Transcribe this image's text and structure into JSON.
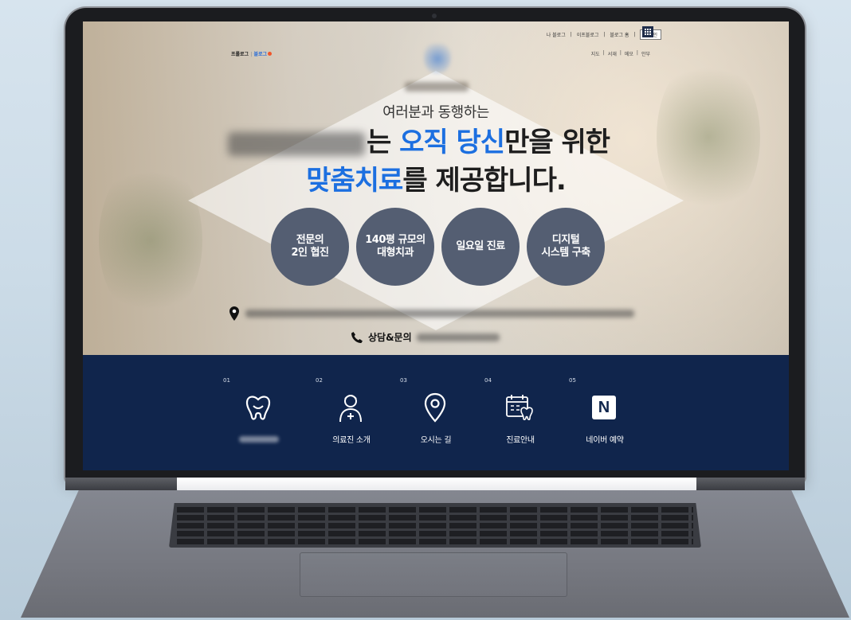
{
  "header": {
    "util_links": [
      "나 블로그",
      "이프블로그",
      "블로그 홈",
      "로그인"
    ],
    "util_links2": [
      "지도",
      "서재",
      "메모",
      "안부"
    ],
    "brand_links": {
      "prologue": "프롤로그",
      "blog": "블로그"
    }
  },
  "hero": {
    "pretitle": "여러분과 동행하는",
    "headline_line1": {
      "after_name": "는 ",
      "blue": "오직 당신",
      "rest": "만을 위한"
    },
    "headline_line2": {
      "blue": "맞춤치료",
      "rest": "를 제공합니다."
    },
    "features": [
      {
        "label": "전문의\n2인 협진"
      },
      {
        "label": "140평 규모의\n대형치과"
      },
      {
        "label": "일요일 진료"
      },
      {
        "label": "디지털\n시스템 구축"
      }
    ],
    "contact_label": "상담&문의"
  },
  "nav": {
    "items": [
      {
        "num": "01",
        "label": "",
        "icon": "tooth-icon"
      },
      {
        "num": "02",
        "label": "의료진 소개",
        "icon": "doctor-icon"
      },
      {
        "num": "03",
        "label": "오시는 길",
        "icon": "location-pin-icon"
      },
      {
        "num": "04",
        "label": "진료안내",
        "icon": "calendar-tooth-icon"
      },
      {
        "num": "05",
        "label": "네이버 예약",
        "icon": "naver-icon"
      }
    ],
    "naver_letter": "N"
  },
  "colors": {
    "accent_blue": "#1c6fe0",
    "nav_bg": "#10254c",
    "circle_bg": "#545e72"
  }
}
